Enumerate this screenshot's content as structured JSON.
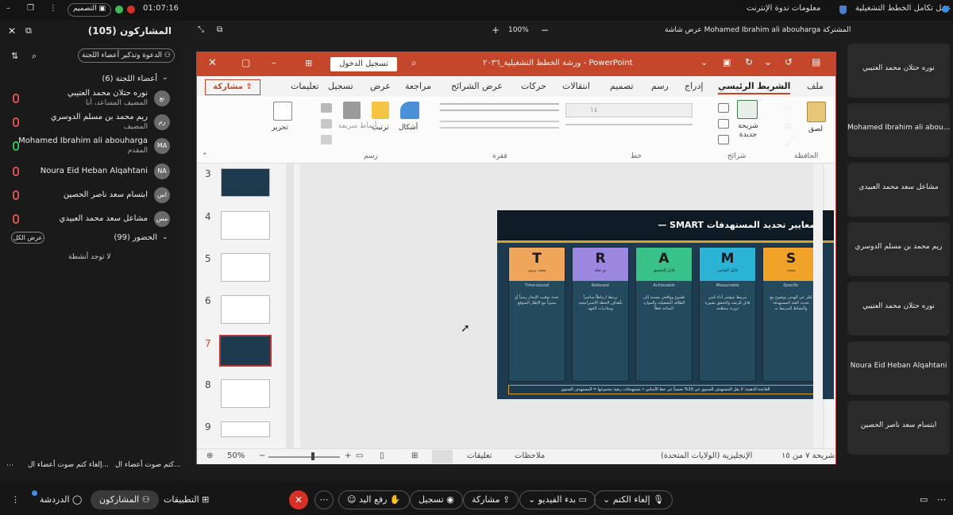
{
  "topbar": {
    "time": "01:07:16",
    "design_label": "التصميم",
    "meeting_title": "ورشة عمل تكامل الخطط التشغيلية",
    "network_info": "معلومات ندوة الإنترنت"
  },
  "share_header": {
    "caption": "عرض شاشة Mohamed Ibrahim ali abouharga المشتركة",
    "zoom": "100%"
  },
  "left_panel": {
    "title": "المشاركون (105)",
    "invite_label": "الدعوة وتذكير أعضاء اللجنة",
    "committee_header": "أعضاء اللجنة (6)",
    "members": [
      {
        "name": "نوره حتلان محمد العتيبي",
        "role": "المضيف المساعد، أنا",
        "initials": "نع",
        "mic": "muted"
      },
      {
        "name": "ريم محمد بن مسلم الدوسري",
        "role": "المضيف",
        "initials": "رم",
        "mic": "muted"
      },
      {
        "name": "Mohamed Ibrahim ali abouharga",
        "role": "المقدم",
        "initials": "MA",
        "mic": "on"
      },
      {
        "name": "Noura Eid Heban Alqahtani",
        "role": "",
        "initials": "NA",
        "mic": "muted"
      },
      {
        "name": "ابتسام سعد ناصر الحصين",
        "role": "",
        "initials": "اس",
        "mic": "muted"
      },
      {
        "name": "مشاعل سعد محمد العبيدي",
        "role": "",
        "initials": "مس",
        "mic": "muted"
      }
    ],
    "attendance_header": "الحضور (99)",
    "show_all": "عرض الكل",
    "no_activity": "لا توجد أنشطة",
    "mute_all": "كتم صوت أعضاء ال...",
    "unmute_all": "إلغاء كتم صوت أعضاء ال..."
  },
  "ppt": {
    "window_title": "ورشة الخطط التشغيلية_٢٠٣٦ - PowerPoint",
    "signin": "تسجيل الدخول",
    "tabs": [
      "ملف",
      "الشريط الرئيسي",
      "إدراج",
      "رسم",
      "تصميم",
      "انتقالات",
      "حركات",
      "عرض الشرائح",
      "مراجعة",
      "عرض",
      "تسجيل",
      "تعليمات"
    ],
    "share": "مشاركة",
    "ribbon": {
      "paste": "لصق",
      "new_slide": "شريحة جديدة",
      "shapes": "أشكال",
      "arrange": "ترتيب",
      "quick_styles": "أنماط سريعة",
      "edit": "تحرير",
      "font_size": "١٤",
      "groups": [
        "الحافظة",
        "شرائح",
        "خط",
        "فقرة",
        "رسم"
      ]
    },
    "thumbnails": [
      "3",
      "4",
      "5",
      "6",
      "7",
      "8",
      "9"
    ],
    "status": {
      "slide_info": "شريحة ٧ من ١٥",
      "language": "الإنجليزية (الولايات المتحدة)",
      "notes": "ملاحظات",
      "comments": "تعليقات",
      "zoom": "50%"
    }
  },
  "slide": {
    "title": "معايير تحديد المستهدفات SMART —",
    "columns": [
      {
        "letter": "T",
        "ar": "محدد بزمن",
        "en": "Time-bound",
        "desc": "تحدد توقيت الإنجاز زمنياً أو سنوياً مع الإطار المتوقع",
        "color": "#f0a65a"
      },
      {
        "letter": "R",
        "ar": "ذو صلة",
        "en": "Relevant",
        "desc": "يرتبط ارتباطاً مباشراً بأهداف الخطة الاستراتيجية ومبادرات الجهة",
        "color": "#9b86e0"
      },
      {
        "letter": "A",
        "ar": "قابل للتحقيق",
        "en": "Achievable",
        "desc": "طموح وواقعي مستند إلى الطاقة التشغيلية والموارد المتاحة فعلاً",
        "color": "#38c28a"
      },
      {
        "letter": "M",
        "ar": "قابل للقياس",
        "en": "Measurable",
        "desc": "مرتبط بمؤشر أداء كمي قابل للرصد والتحقق بصورة دورية منتظمة",
        "color": "#2bb3d6"
      },
      {
        "letter": "S",
        "ar": "محدد",
        "en": "Specific",
        "desc": "يُعبّر عن الهدف بوضوح مع تحديد الفئة المستهدفة والنشاط المرتبط به",
        "color": "#f0a328"
      }
    ],
    "footer": "القاعدة الذهبية: لا يقل المستهدف السنوي عن 10% تحسناً عن خط الأساس  •  مستهدفات ربعية مجموعها = المستهدف السنوي"
  },
  "right_panel": {
    "tiles": [
      "نوره حتلان محمد العتيبي",
      "Mohamed Ibrahim ali abou...",
      "مشاعل سعد محمد العبيدي",
      "ريم محمد بن مسلم الدوسري",
      "نوره حتلان محمد العتيبي",
      "Noura Eid Heban Alqahtani",
      "ابتسام سعد ناصر الحصين"
    ]
  },
  "bottombar": {
    "chat": "الدردشة",
    "participants": "المشاركون",
    "apps": "التطبيقات",
    "raise_hand": "رفع اليد",
    "record": "تسجيل",
    "share": "مشاركة",
    "start_video": "بدء الفيديو",
    "unmute": "إلغاء الكتم"
  },
  "colors": {
    "ppt_accent": "#c4472c",
    "leave": "#d93025"
  }
}
